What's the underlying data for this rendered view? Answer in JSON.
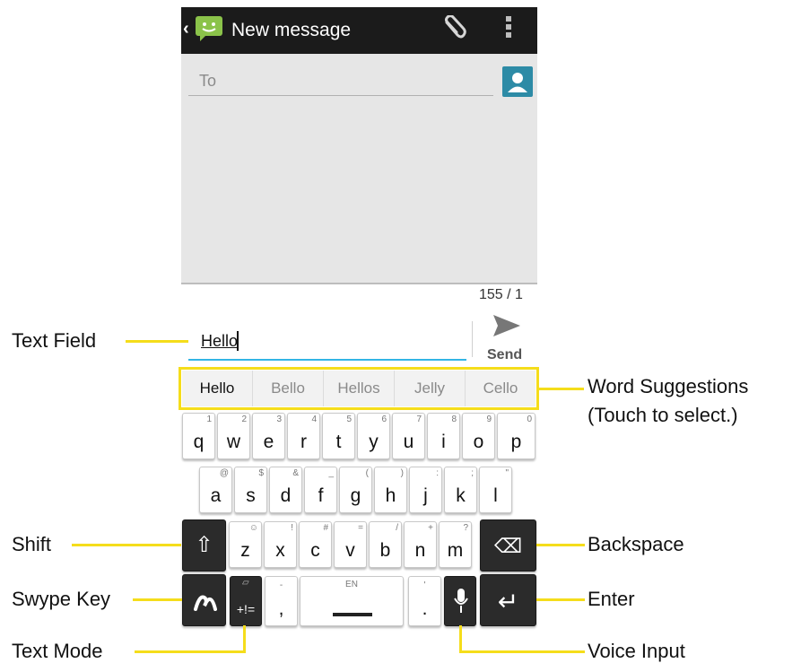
{
  "app": {
    "title": "New message",
    "back_label": "‹",
    "icons": {
      "app": "messaging-app-icon",
      "attach": "paperclip-icon",
      "menu": "overflow-menu-icon",
      "contact": "contact-picker-icon"
    }
  },
  "compose": {
    "to_placeholder": "To",
    "counter": "155 / 1"
  },
  "message": {
    "value": "Hello",
    "send_label": "Send"
  },
  "suggestions": [
    "Hello",
    "Bello",
    "Hellos",
    "Jelly",
    "Cello"
  ],
  "keyboard": {
    "row1": [
      {
        "label": "q",
        "sub": "1"
      },
      {
        "label": "w",
        "sub": "2"
      },
      {
        "label": "e",
        "sub": "3"
      },
      {
        "label": "r",
        "sub": "4"
      },
      {
        "label": "t",
        "sub": "5"
      },
      {
        "label": "y",
        "sub": "6"
      },
      {
        "label": "u",
        "sub": "7"
      },
      {
        "label": "i",
        "sub": "8"
      },
      {
        "label": "o",
        "sub": "9"
      },
      {
        "label": "p",
        "sub": "0"
      }
    ],
    "row2": [
      {
        "label": "a",
        "sub": "@"
      },
      {
        "label": "s",
        "sub": "$"
      },
      {
        "label": "d",
        "sub": "&"
      },
      {
        "label": "f",
        "sub": "_"
      },
      {
        "label": "g",
        "sub": "("
      },
      {
        "label": "h",
        "sub": ")"
      },
      {
        "label": "j",
        "sub": ":"
      },
      {
        "label": "k",
        "sub": ";"
      },
      {
        "label": "l",
        "sub": "\""
      }
    ],
    "row3": [
      {
        "label": "z",
        "sub": "☺"
      },
      {
        "label": "x",
        "sub": "!"
      },
      {
        "label": "c",
        "sub": "#"
      },
      {
        "label": "v",
        "sub": "="
      },
      {
        "label": "b",
        "sub": "/"
      },
      {
        "label": "n",
        "sub": "+"
      },
      {
        "label": "m",
        "sub": "?"
      }
    ],
    "shift_label": "⇧",
    "backspace_label": "⌫",
    "swype_label": "ʃ",
    "textmode_label": "+!=",
    "comma_label": ",",
    "comma_sub": "-",
    "space_sub": "EN",
    "period_label": ".",
    "period_sub": "'",
    "enter_label": "↵"
  },
  "callouts": {
    "text_field": "Text Field",
    "word_suggestions_1": "Word Suggestions",
    "word_suggestions_2": "(Touch to select.)",
    "shift": "Shift",
    "backspace": "Backspace",
    "swype_key": "Swype Key",
    "enter": "Enter",
    "text_mode": "Text Mode",
    "voice_input": "Voice Input"
  },
  "colors": {
    "callout_line": "#f5dd1b",
    "accent": "#33b5e5",
    "appbar": "#1b1b1b",
    "contact": "#2d8ba6"
  }
}
